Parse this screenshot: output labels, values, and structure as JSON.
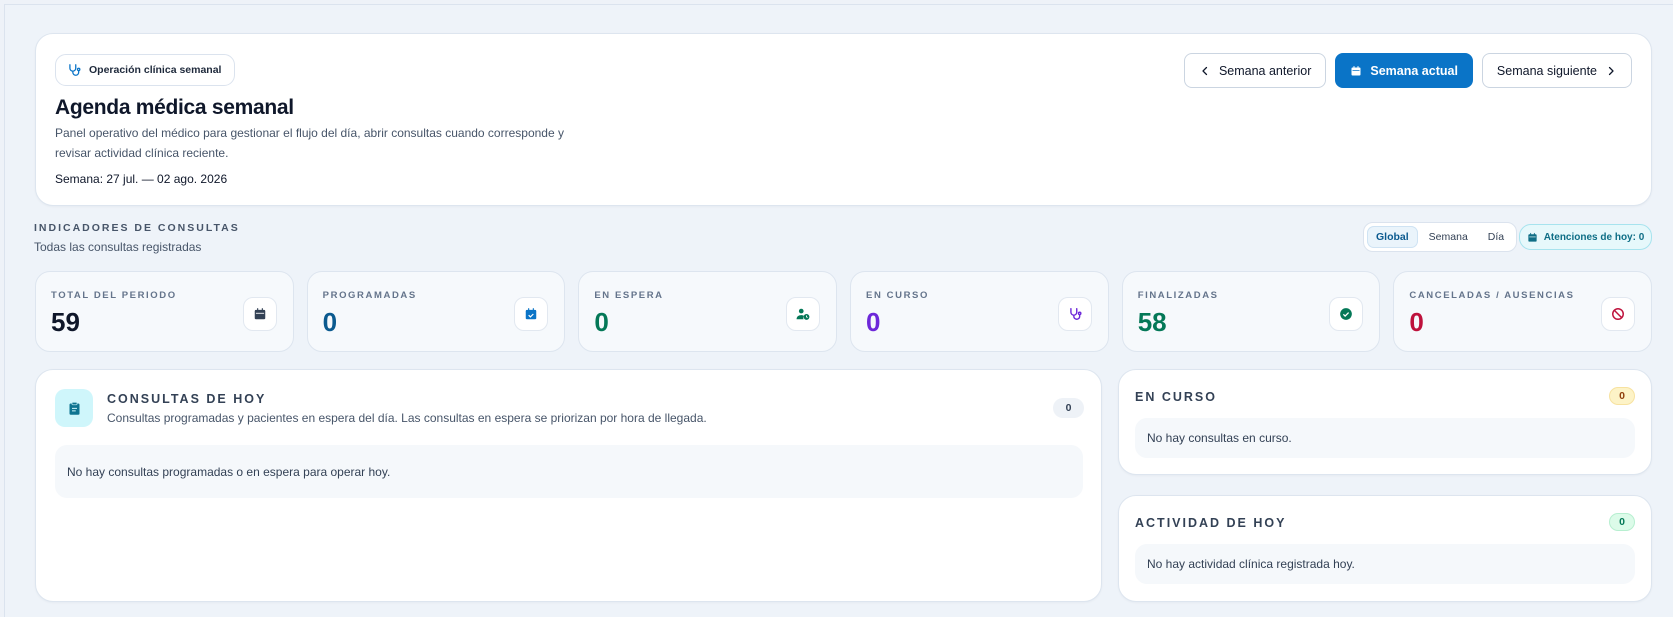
{
  "header": {
    "badge": "Operación clínica semanal",
    "title": "Agenda médica semanal",
    "description": "Panel operativo del médico para gestionar el flujo del día, abrir consultas cuando corresponde y revisar actividad clínica reciente.",
    "week": "Semana: 27 jul. — 02 ago. 2026",
    "nav": {
      "prev": "Semana anterior",
      "current": "Semana actual",
      "next": "Semana siguiente"
    }
  },
  "indicators": {
    "title": "INDICADORES DE CONSULTAS",
    "subtitle": "Todas las consultas registradas",
    "scope": {
      "global": "Global",
      "week": "Semana",
      "day": "Día",
      "selected": "Global"
    },
    "today_chip": "Atenciones de hoy: 0"
  },
  "stats": [
    {
      "label": "TOTAL DEL PERIODO",
      "value": "59",
      "color": "#0f172a",
      "icon": "calendar-icon"
    },
    {
      "label": "PROGRAMADAS",
      "value": "0",
      "color": "#0b5a8f",
      "icon": "calendar-check-icon"
    },
    {
      "label": "EN ESPERA",
      "value": "0",
      "color": "#047857",
      "icon": "user-clock-icon"
    },
    {
      "label": "EN CURSO",
      "value": "0",
      "color": "#6d28d9",
      "icon": "stethoscope-icon"
    },
    {
      "label": "FINALIZADAS",
      "value": "58",
      "color": "#047857",
      "icon": "check-circle-icon"
    },
    {
      "label": "CANCELADAS / AUSENCIAS",
      "value": "0",
      "color": "#be123c",
      "icon": "ban-icon"
    }
  ],
  "today": {
    "title": "CONSULTAS DE HOY",
    "subtitle": "Consultas programadas y pacientes en espera del día. Las consultas en espera se priorizan por hora de llegada.",
    "count": "0",
    "empty": "No hay consultas programadas o en espera para operar hoy."
  },
  "in_progress": {
    "title": "EN CURSO",
    "count": "0",
    "empty": "No hay consultas en curso."
  },
  "activity": {
    "title": "ACTIVIDAD DE HOY",
    "count": "0",
    "empty": "No hay actividad clínica registrada hoy."
  },
  "colors": {
    "primary": "#0a74c7",
    "background": "#eef3f9"
  }
}
